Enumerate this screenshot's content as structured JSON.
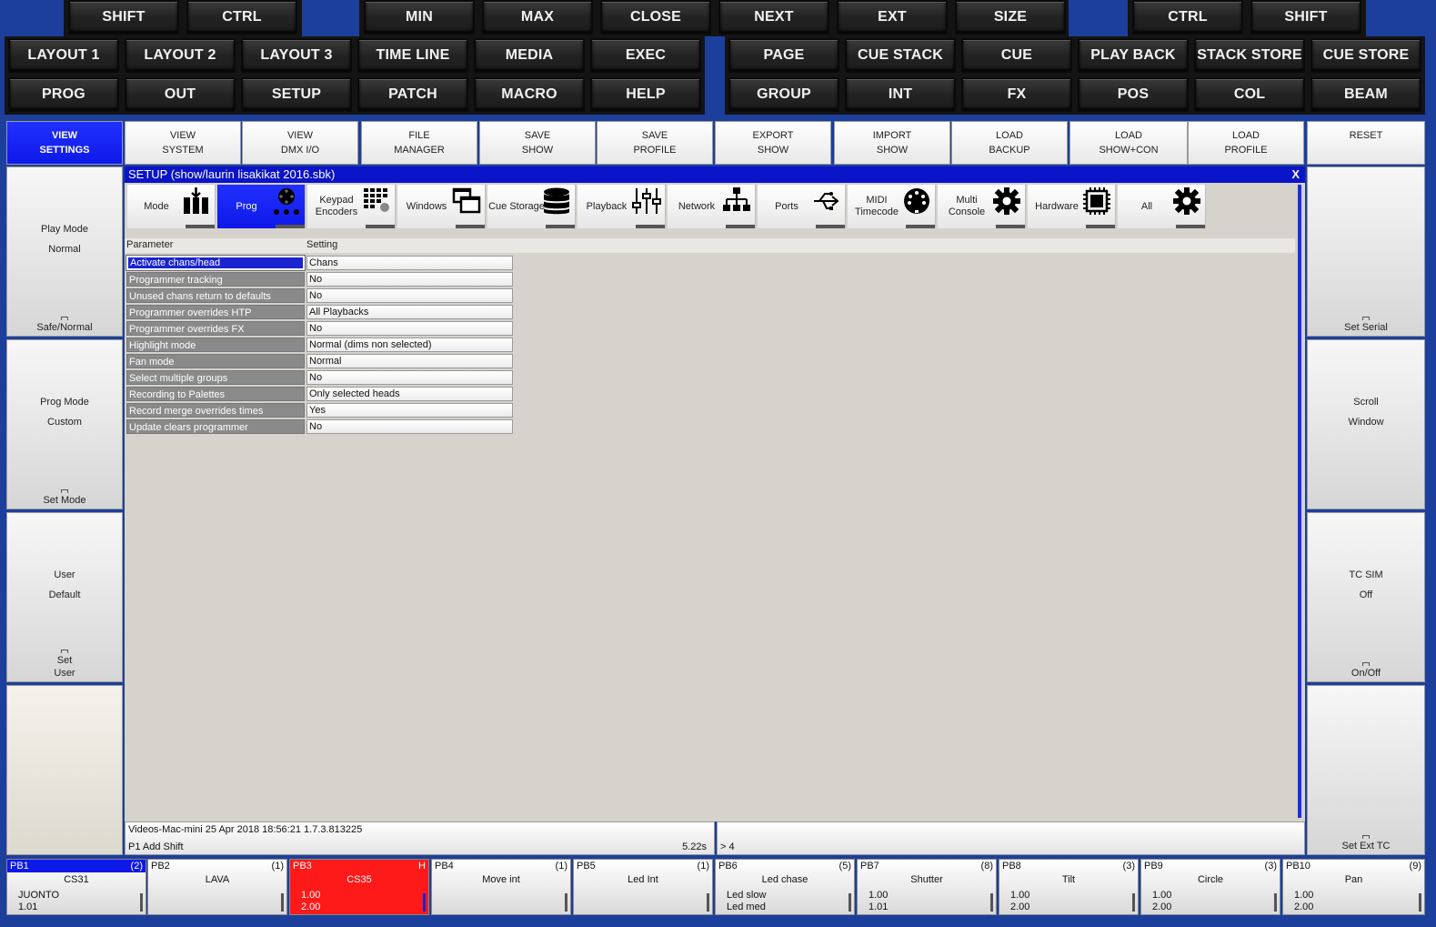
{
  "top_keys": {
    "row1": [
      "SHIFT",
      "CTRL",
      "MIN",
      "MAX",
      "CLOSE",
      "NEXT",
      "EXT",
      "SIZE",
      "CTRL",
      "SHIFT"
    ],
    "row2": [
      "LAYOUT 1",
      "LAYOUT 2",
      "LAYOUT 3",
      "TIME LINE",
      "MEDIA",
      "EXEC",
      "PAGE",
      "CUE STACK",
      "CUE",
      "PLAY BACK",
      "STACK STORE",
      "CUE STORE"
    ],
    "row3": [
      "PROG",
      "OUT",
      "SETUP",
      "PATCH",
      "MACRO",
      "HELP",
      "GROUP",
      "INT",
      "FX",
      "POS",
      "COL",
      "BEAM"
    ]
  },
  "soft_buttons": [
    {
      "l1": "VIEW",
      "l2": "SETTINGS"
    },
    {
      "l1": "VIEW",
      "l2": "SYSTEM"
    },
    {
      "l1": "VIEW",
      "l2": "DMX I/O"
    },
    {
      "l1": "FILE",
      "l2": "MANAGER"
    },
    {
      "l1": "SAVE",
      "l2": "SHOW"
    },
    {
      "l1": "SAVE",
      "l2": "PROFILE"
    },
    {
      "l1": "EXPORT",
      "l2": "SHOW"
    },
    {
      "l1": "IMPORT",
      "l2": "SHOW"
    },
    {
      "l1": "LOAD",
      "l2": "BACKUP"
    },
    {
      "l1": "LOAD",
      "l2": "SHOW+CON"
    },
    {
      "l1": "LOAD",
      "l2": "PROFILE"
    },
    {
      "l1": "RESET",
      "l2": ""
    }
  ],
  "left_panels": [
    {
      "l1": "Play Mode",
      "l2": "Normal",
      "foot1": "Safe/Normal",
      "foot2": ""
    },
    {
      "l1": "Prog Mode",
      "l2": "Custom",
      "foot1": "Set Mode",
      "foot2": ""
    },
    {
      "l1": "User",
      "l2": "Default",
      "foot1": "Set",
      "foot2": "User"
    }
  ],
  "right_panels": [
    {
      "l1": "",
      "l2": "",
      "foot1": "Set Serial"
    },
    {
      "l1": "Scroll",
      "l2": "Window",
      "foot1": ""
    },
    {
      "l1": "TC SIM",
      "l2": "Off",
      "foot1": "On/Off"
    },
    {
      "l1": "",
      "l2": "",
      "foot1": "Set Ext TC"
    }
  ],
  "window": {
    "title": "SETUP (show/laurin lisakikat 2016.sbk)",
    "close": "X",
    "tabs": [
      {
        "label": "Mode",
        "icon": "faders-icon"
      },
      {
        "label": "Prog",
        "icon": "programmer-icon"
      },
      {
        "label": "Keypad Encoders",
        "icon": "keypad-icon"
      },
      {
        "label": "Windows",
        "icon": "windows-icon"
      },
      {
        "label": "Cue Storage",
        "icon": "database-icon"
      },
      {
        "label": "Playback",
        "icon": "sliders-icon"
      },
      {
        "label": "Network",
        "icon": "network-icon"
      },
      {
        "label": "Ports",
        "icon": "usb-icon"
      },
      {
        "label": "MIDI Timecode",
        "icon": "midi-icon"
      },
      {
        "label": "Multi Console",
        "icon": "gear-icon"
      },
      {
        "label": "Hardware",
        "icon": "chip-icon"
      },
      {
        "label": "All",
        "icon": "gear-icon"
      }
    ],
    "columns": [
      "Parameter",
      "Setting"
    ],
    "rows": [
      {
        "param": "Activate chans/head",
        "value": "Chans"
      },
      {
        "param": "Programmer tracking",
        "value": "No"
      },
      {
        "param": "Unused chans return to defaults",
        "value": "No"
      },
      {
        "param": "Programmer overrides HTP",
        "value": "All Playbacks"
      },
      {
        "param": "Programmer overrides FX",
        "value": "No"
      },
      {
        "param": "Highlight mode",
        "value": "Normal (dims non selected)"
      },
      {
        "param": "Fan mode",
        "value": "Normal"
      },
      {
        "param": "Select multiple groups",
        "value": "No"
      },
      {
        "param": "Recording to Palettes",
        "value": "Only selected heads"
      },
      {
        "param": "Record merge overrides times",
        "value": "Yes"
      },
      {
        "param": "Update clears programmer",
        "value": "No"
      }
    ]
  },
  "status": {
    "line1": "Videos-Mac-mini 25 Apr 2018 18:56:21 1.7.3.813225",
    "line2": "P1  Add Shift",
    "time": "5.22s",
    "cmd": "> 4"
  },
  "playbacks": [
    {
      "id": "PB1",
      "count": "(2)",
      "name": "CS31",
      "t1": "JUONTO",
      "t2": "1.01"
    },
    {
      "id": "PB2",
      "count": "(1)",
      "name": "LAVA",
      "t1": "",
      "t2": ""
    },
    {
      "id": "PB3",
      "count": "H",
      "name": "CS35",
      "t1": "1.00",
      "t2": "2.00"
    },
    {
      "id": "PB4",
      "count": "(1)",
      "name": "Move int",
      "t1": "",
      "t2": ""
    },
    {
      "id": "PB5",
      "count": "(1)",
      "name": "Led Int",
      "t1": "",
      "t2": ""
    },
    {
      "id": "PB6",
      "count": "(5)",
      "name": "Led chase",
      "t1": "Led slow",
      "t2": "Led med"
    },
    {
      "id": "PB7",
      "count": "(8)",
      "name": "Shutter",
      "t1": "1.00",
      "t2": "1.01"
    },
    {
      "id": "PB8",
      "count": "(3)",
      "name": "Tilt",
      "t1": "1.00",
      "t2": "2.00"
    },
    {
      "id": "PB9",
      "count": "(3)",
      "name": "Circle",
      "t1": "1.00",
      "t2": "2.00"
    },
    {
      "id": "PB10",
      "count": "(9)",
      "name": "Pan",
      "t1": "1.00",
      "t2": "2.00"
    }
  ],
  "colors": {
    "accent": "#0d19e8",
    "active_playback": "#ff1a1a",
    "background": "#1c3f9c"
  }
}
